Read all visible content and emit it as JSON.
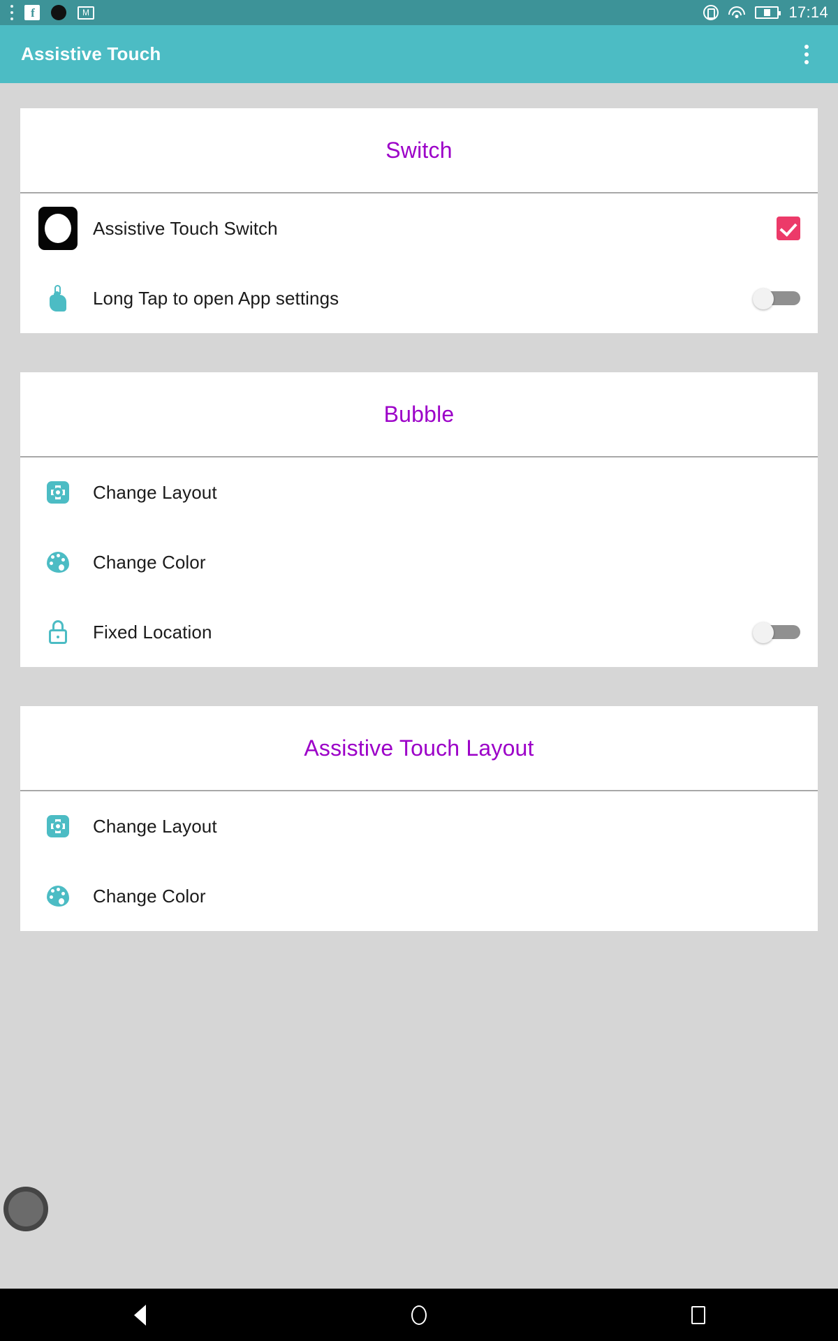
{
  "status_bar": {
    "time": "17:14",
    "left_icons": [
      "menu-dots-icon",
      "facebook-icon",
      "black-circle-icon",
      "gmail-icon"
    ],
    "right_icons": [
      "vibrate-icon",
      "wifi-icon",
      "battery-icon"
    ],
    "facebook_glyph": "f",
    "background_color": "#3d9398"
  },
  "toolbar": {
    "title": "Assistive Touch",
    "overflow_label": "overflow-menu",
    "background_color": "#4cbcc4"
  },
  "theme": {
    "accent_teal": "#4cbcc4",
    "header_purple": "#9c00c8",
    "checkbox_pink": "#ec3a69",
    "page_background": "#d6d6d6",
    "card_background": "#ffffff"
  },
  "sections": [
    {
      "header": "Switch",
      "rows": [
        {
          "label": "Assistive Touch Switch",
          "icon": "assistive-touch-app-icon",
          "control": "checkbox",
          "checked": true
        },
        {
          "label": "Long Tap to open App settings",
          "icon": "touch-icon",
          "control": "toggle",
          "checked": false
        }
      ]
    },
    {
      "header": "Bubble",
      "rows": [
        {
          "label": "Change Layout",
          "icon": "gear-icon",
          "control": "none"
        },
        {
          "label": "Change Color",
          "icon": "palette-icon",
          "control": "none"
        },
        {
          "label": "Fixed Location",
          "icon": "lock-icon",
          "control": "toggle",
          "checked": false
        }
      ]
    },
    {
      "header": "Assistive Touch Layout",
      "rows": [
        {
          "label": "Change Layout",
          "icon": "gear-icon",
          "control": "none"
        },
        {
          "label": "Change Color",
          "icon": "palette-icon",
          "control": "none"
        }
      ]
    }
  ],
  "floating_bubble": {
    "name": "assistive-touch-bubble",
    "color": "#6b6b6b"
  },
  "nav_bar": {
    "back_label": "Back",
    "home_label": "Home",
    "recents_label": "Recents"
  }
}
